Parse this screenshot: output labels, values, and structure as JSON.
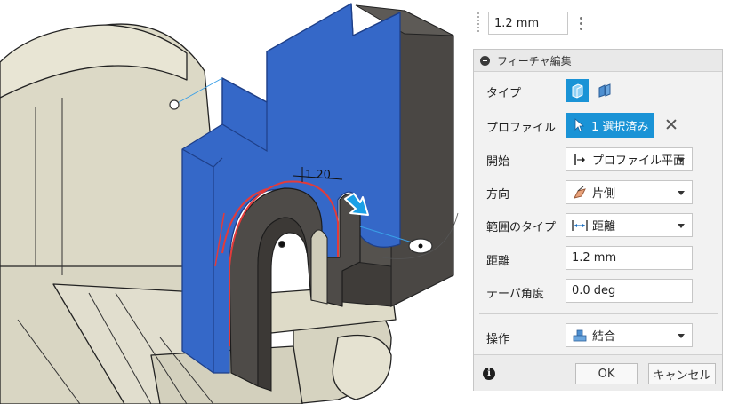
{
  "toolbar": {
    "distance_value": "1.2 mm"
  },
  "panel": {
    "title": "フィーチャ編集",
    "labels": {
      "type": "タイプ",
      "profile": "プロファイル",
      "start": "開始",
      "direction": "方向",
      "extent_type": "範囲のタイプ",
      "distance": "距離",
      "taper_angle": "テーパ角度",
      "operation": "操作"
    },
    "profile_selection": "1 選択済み",
    "start_value": "プロファイル平面",
    "direction_value": "片側",
    "extent_value": "距離",
    "distance_value": "1.2 mm",
    "taper_value": "0.0 deg",
    "operation_value": "結合",
    "ok_label": "OK",
    "cancel_label": "キャンセル"
  },
  "viewport": {
    "dimension_label": "1.20"
  },
  "colors": {
    "accent": "#1a93d6",
    "body_face": "#3568c8",
    "model_tan": "#dedbc8",
    "model_dark": "#4a4744"
  }
}
